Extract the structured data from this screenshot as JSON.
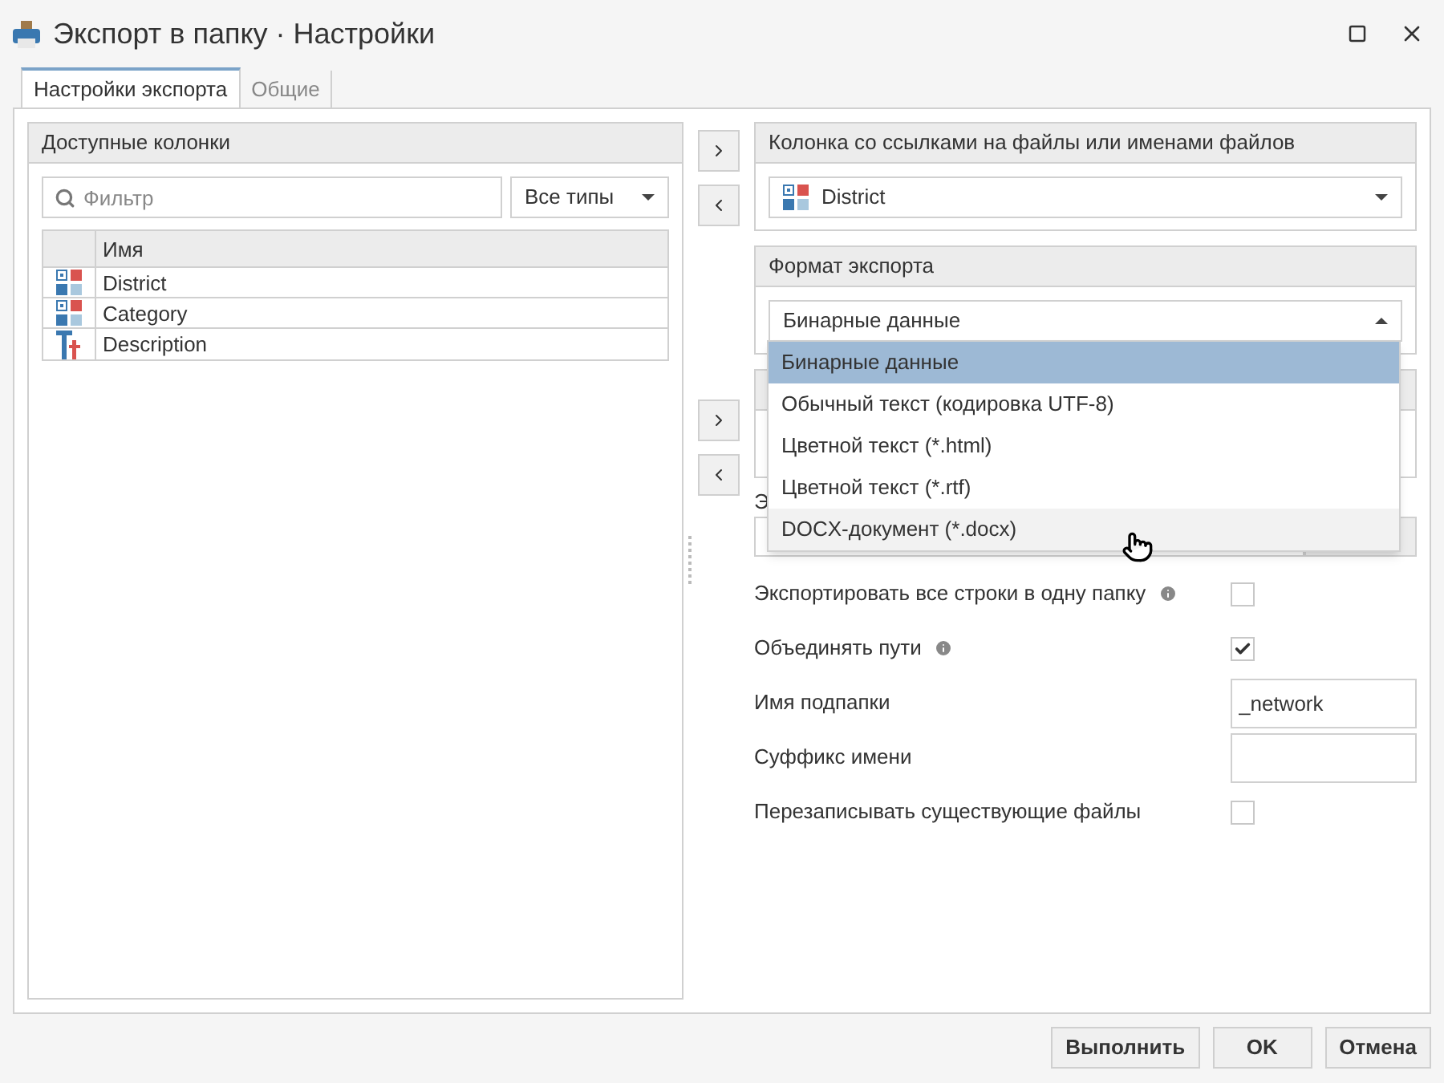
{
  "window": {
    "title": "Экспорт в папку · Настройки"
  },
  "tabs": [
    {
      "label": "Настройки экспорта",
      "selected": true
    },
    {
      "label": "Общие",
      "selected": false
    }
  ],
  "available_columns": {
    "title": "Доступные колонки",
    "filter": {
      "placeholder": "Фильтр"
    },
    "type_select": "Все типы",
    "table": {
      "columns": [
        "Имя"
      ],
      "rows": [
        {
          "name": "District",
          "kind": "category"
        },
        {
          "name": "Category",
          "kind": "category"
        },
        {
          "name": "Description",
          "kind": "text"
        }
      ]
    }
  },
  "file_column": {
    "title": "Колонка со ссылками на файлы или именами файлов",
    "value": "District",
    "kind": "category"
  },
  "export_format": {
    "title": "Формат экспорта",
    "value": "Бинарные данные",
    "expanded": true,
    "options": [
      {
        "label": "Бинарные данные",
        "selected": true,
        "hovered": false
      },
      {
        "label": "Обычный текст (кодировка UTF-8)",
        "selected": false,
        "hovered": false
      },
      {
        "label": "Цветной текст (*.html)",
        "selected": false,
        "hovered": false
      },
      {
        "label": "Цветной текст (*.rtf)",
        "selected": false,
        "hovered": false
      },
      {
        "label": "DOCX-документ (*.docx)",
        "selected": false,
        "hovered": true
      }
    ]
  },
  "folder": {
    "label": "Э"
  },
  "options": [
    {
      "kind": "checkbox",
      "label": "Экспортировать все строки в одну папку",
      "info": true,
      "checked": false
    },
    {
      "kind": "checkbox",
      "label": "Объединять пути",
      "info": true,
      "checked": true
    },
    {
      "kind": "text",
      "label": "Имя подпапки",
      "value": "_network"
    },
    {
      "kind": "text",
      "label": "Суффикс имени"
    },
    {
      "kind": "checkbox",
      "label": "Перезаписывать существующие файлы",
      "info": false,
      "checked": false
    }
  ],
  "buttons": [
    {
      "label": "Выполнить"
    },
    {
      "label": "OK"
    },
    {
      "label": "Отмена"
    }
  ]
}
